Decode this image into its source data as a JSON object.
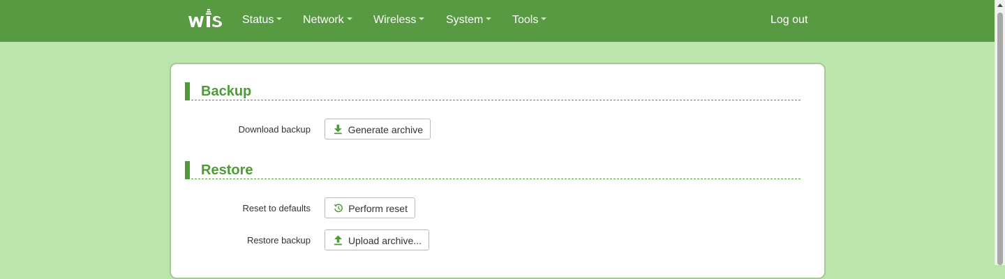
{
  "header": {
    "logo_text": "wis",
    "menu": [
      {
        "label": "Status"
      },
      {
        "label": "Network"
      },
      {
        "label": "Wireless"
      },
      {
        "label": "System"
      },
      {
        "label": "Tools"
      }
    ],
    "logout_label": "Log out"
  },
  "backup": {
    "title": "Backup",
    "download_label": "Download backup",
    "generate_button": "Generate archive",
    "generate_icon": "download-arrow-icon"
  },
  "restore": {
    "title": "Restore",
    "reset_label": "Reset to defaults",
    "reset_button": "Perform reset",
    "reset_icon": "history-icon",
    "restore_label": "Restore backup",
    "upload_button": "Upload archive...",
    "upload_icon": "upload-arrow-icon"
  },
  "colors": {
    "navbar": "#589a42",
    "page_background": "#bce4ad",
    "accent": "#4e9a36"
  }
}
